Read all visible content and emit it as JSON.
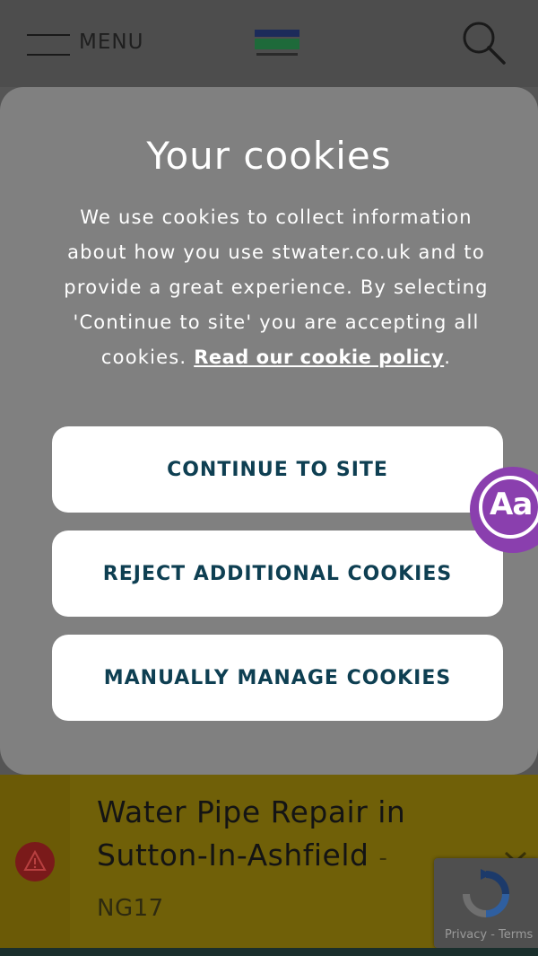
{
  "header": {
    "menu_label": "MENU",
    "logo_icon": "water-company-logo",
    "search_icon": "search-icon"
  },
  "cookie_modal": {
    "title": "Your cookies",
    "body_text": "We use cookies to collect information about how you use stwater.co.uk and to provide a great experience. By selecting 'Continue to site' you are accepting all cookies.",
    "policy_link": "Read our cookie policy",
    "policy_suffix": ".",
    "buttons": {
      "continue": "CONTINUE TO SITE",
      "reject": "REJECT ADDITIONAL COOKIES",
      "manage": "MANUALLY MANAGE COOKIES"
    }
  },
  "accessibility_button": {
    "label": "Aa",
    "color": "#8a3fae"
  },
  "alert": {
    "title": "Water Pipe Repair in Sutton-In-Ashfield",
    "separator": "-",
    "postcode": "NG17",
    "icon": "warning-icon",
    "background": "#706008"
  },
  "recaptcha": {
    "text": "Privacy - Terms"
  },
  "colors": {
    "button_text": "#0e3f52",
    "modal_bg": "#808080",
    "overlay": "#555555"
  }
}
